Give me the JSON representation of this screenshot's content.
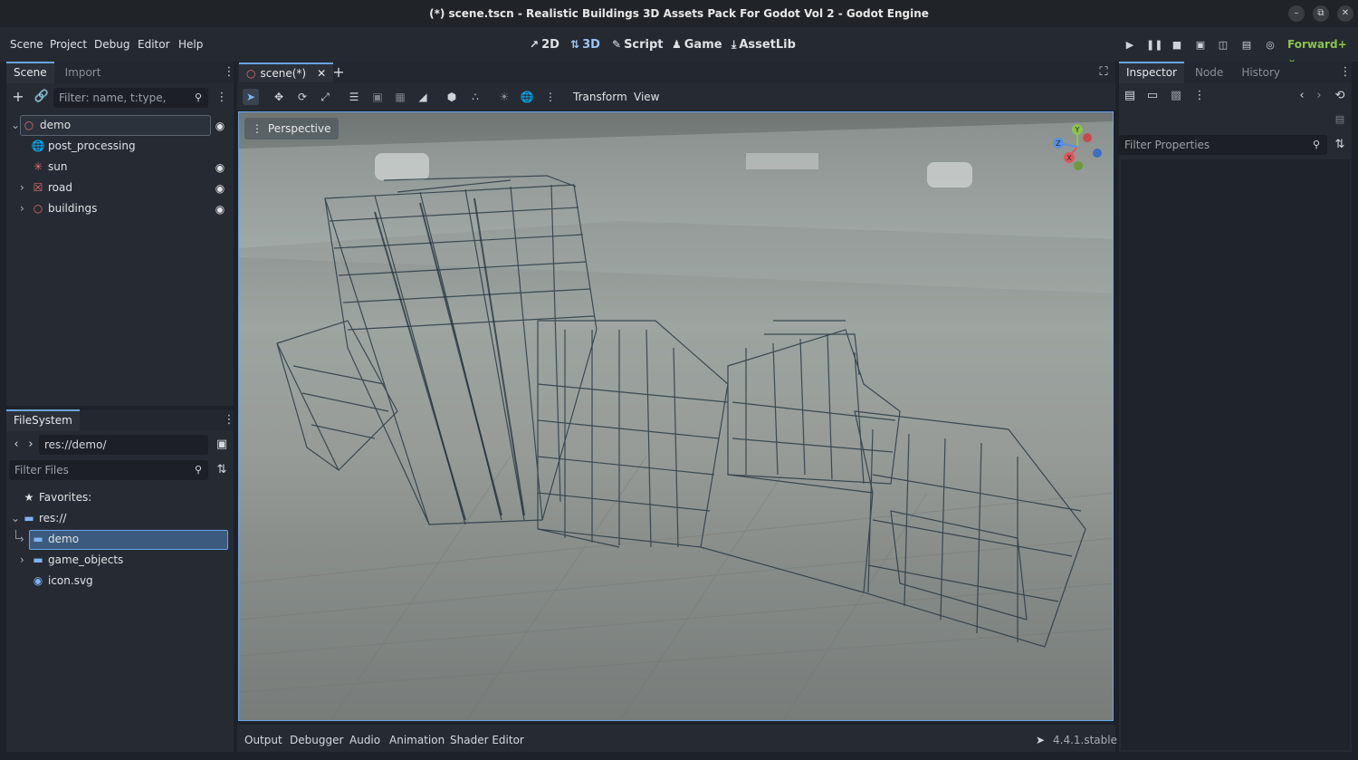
{
  "window": {
    "title": "(*) scene.tscn - Realistic Buildings 3D Assets Pack For Godot Vol 2 - Godot Engine",
    "controls": [
      "minimize-icon",
      "restore-icon",
      "close-icon"
    ]
  },
  "menu": [
    "Scene",
    "Project",
    "Debug",
    "Editor",
    "Help"
  ],
  "modes": [
    {
      "label": "2D",
      "icon": "2d-icon"
    },
    {
      "label": "3D",
      "icon": "3d-icon",
      "active": true
    },
    {
      "label": "Script",
      "icon": "script-icon"
    },
    {
      "label": "Game",
      "icon": "game-icon"
    },
    {
      "label": "AssetLib",
      "icon": "assetlib-icon"
    }
  ],
  "run_controls": [
    "play-icon",
    "pause-icon",
    "stop-icon",
    "remote-debug-icon",
    "movie-icon",
    "clapper-icon",
    "profiler-icon"
  ],
  "renderer": "Forward+",
  "scene_dock": {
    "tabs": [
      "Scene",
      "Import"
    ],
    "filter_placeholder": "Filter: name, t:type, g:group",
    "nodes": [
      {
        "name": "demo",
        "icon": "node3d-icon",
        "selected": true,
        "visible": true,
        "expandable": true
      },
      {
        "name": "post_processing",
        "icon": "world-env-icon",
        "visible": null
      },
      {
        "name": "sun",
        "icon": "light-icon",
        "visible": true
      },
      {
        "name": "road",
        "icon": "scene-instance-icon",
        "visible": true,
        "expandable": true
      },
      {
        "name": "buildings",
        "icon": "node3d-icon",
        "visible": true,
        "expandable": true
      }
    ]
  },
  "filesystem_dock": {
    "tab": "FileSystem",
    "path": "res://demo/",
    "filter_placeholder": "Filter Files",
    "favorites_label": "Favorites:",
    "items": [
      {
        "name": "res://",
        "type": "folder",
        "level": 0
      },
      {
        "name": "demo",
        "type": "folder",
        "level": 1,
        "selected": true
      },
      {
        "name": "game_objects",
        "type": "folder",
        "level": 1
      },
      {
        "name": "icon.svg",
        "type": "file",
        "level": 1
      }
    ]
  },
  "editor_tabs": [
    {
      "label": "scene(*)",
      "closable": true
    }
  ],
  "viewport_toolbar": {
    "tools": [
      "select-icon",
      "move-icon",
      "rotate-icon",
      "scale-icon",
      "list-select-icon",
      "lock-icon",
      "group-icon",
      "ruler-icon",
      "snap-icon",
      "local-space-icon",
      "sun-preview-icon",
      "environment-preview-icon",
      "more-icon"
    ],
    "menus": [
      "Transform",
      "View"
    ]
  },
  "viewport": {
    "label": "Perspective",
    "gizmo_axes": [
      "Y",
      "X",
      "Z"
    ]
  },
  "inspector": {
    "tabs": [
      "Inspector",
      "Node",
      "History"
    ],
    "filter_placeholder": "Filter Properties"
  },
  "bottom_panel": {
    "tabs": [
      "Output",
      "Debugger",
      "Audio",
      "Animation",
      "Shader Editor"
    ],
    "version": "4.4.1.stable"
  },
  "colors": {
    "accent": "#6aa3e8",
    "renderer": "#8cc34b",
    "node_icon": "#e06c6c",
    "folder": "#7fb2f0"
  }
}
